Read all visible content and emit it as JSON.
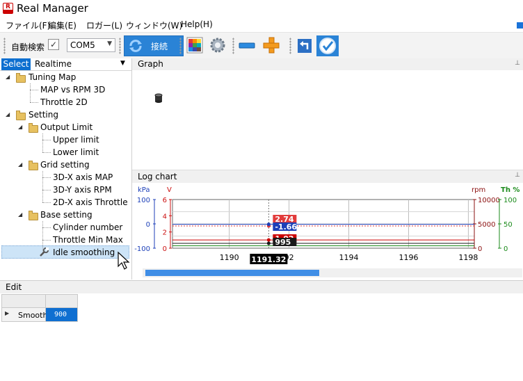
{
  "window": {
    "title": "Real Manager",
    "logo_text": "R"
  },
  "menu": [
    "ファイル(F)",
    "編集(E)",
    "ロガー(L)",
    "ウィンドウ(W)",
    "Help(H)"
  ],
  "toolbar": {
    "auto_detect_label": "自動検索",
    "auto_detect_checked": "✓",
    "port_value": "COM5",
    "connect_label": "接続"
  },
  "select_panel": {
    "select_label": "Select",
    "mode_value": "Realtime"
  },
  "tree": {
    "tuning_map": "Tuning Map",
    "map_vs_rpm": "MAP vs RPM 3D",
    "throttle_2d": "Throttle 2D",
    "setting": "Setting",
    "output_limit": "Output Limit",
    "upper_limit": "Upper limit",
    "lower_limit": "Lower limit",
    "grid_setting": "Grid setting",
    "axis_map": "3D-X axis MAP",
    "axis_rpm": "3D-Y axis RPM",
    "axis_throttle": "2D-X axis Throttle",
    "base_setting": "Base setting",
    "cylinder_number": "Cylinder number",
    "throttle_min_max": "Throttle Min Max",
    "idle_smoothing": "Idle smoothing"
  },
  "graph_panel": {
    "title": "Graph"
  },
  "log_panel": {
    "title": "Log chart"
  },
  "chart_data": {
    "type": "line",
    "x_ticks": [
      "1190",
      "92",
      "1194",
      "1196",
      "1198"
    ],
    "x_tick_values": [
      1190,
      1192,
      1194,
      1196,
      1198
    ],
    "xlim": [
      1188.1,
      1198.2
    ],
    "cursor_x": 1191.32,
    "cursor_label": "1191.32",
    "axes": {
      "kpa": {
        "unit": "kPa",
        "ticks": [
          "100",
          "0",
          "-100"
        ],
        "ylim": [
          -100,
          100
        ],
        "color": "#1c3fb8"
      },
      "v": {
        "unit": "V",
        "ticks": [
          "6",
          "4",
          "2",
          "0"
        ],
        "ylim": [
          0,
          6
        ],
        "color": "#cc1111"
      },
      "rpm": {
        "unit": "rpm",
        "ticks": [
          "10000",
          "5000",
          "0"
        ],
        "ylim": [
          0,
          10000
        ],
        "color": "#8b1010"
      },
      "th": {
        "unit": "Th %",
        "ticks": [
          "100",
          "50",
          "0"
        ],
        "ylim": [
          0,
          100
        ],
        "color": "#1a8a1a"
      }
    },
    "series": [
      {
        "axis": "v",
        "value": 2.74,
        "label": "2.74",
        "color": "#e23b3b",
        "dashed": true
      },
      {
        "axis": "kpa",
        "value": -1.66,
        "label": "-1.66",
        "color": "#1c3fb8",
        "dashed": false
      },
      {
        "axis": "v",
        "value": 1.02,
        "label": "1.02",
        "color": "#cc0000",
        "dashed": false
      },
      {
        "axis": "rpm",
        "value": 995,
        "label": "995",
        "color": "#1a1a1a",
        "dashed": false
      },
      {
        "axis": "th",
        "value": 5,
        "label": "",
        "color": "#1a8a1a",
        "dashed": false
      }
    ]
  },
  "edit_panel": {
    "title": "Edit",
    "row_label": "Smooth",
    "row_value": "900"
  }
}
